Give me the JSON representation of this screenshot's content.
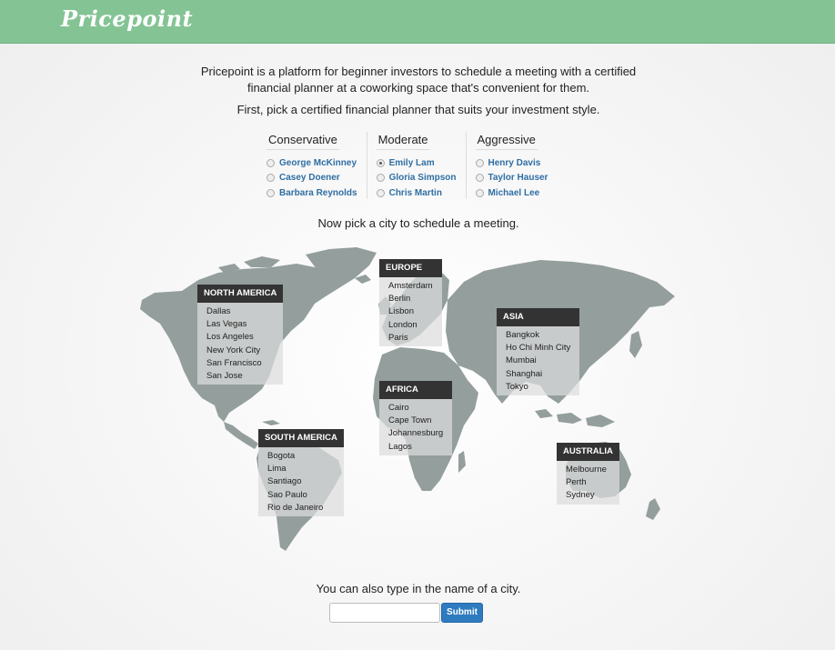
{
  "app": {
    "logo": "Pricepoint"
  },
  "intro": {
    "line1": "Pricepoint is a platform for beginner investors to schedule a meeting with a certified",
    "line2": "financial planner at a coworking space that's convenient for them.",
    "step1": "First, pick a certified financial planner that suits your investment style."
  },
  "planners": [
    {
      "style": "Conservative",
      "names": [
        "George McKinney",
        "Casey Doener",
        "Barbara Reynolds"
      ],
      "selected": null
    },
    {
      "style": "Moderate",
      "names": [
        "Emily Lam",
        "Gloria Simpson",
        "Chris Martin"
      ],
      "selected": 0
    },
    {
      "style": "Aggressive",
      "names": [
        "Henry Davis",
        "Taylor Hauser",
        "Michael Lee"
      ],
      "selected": null
    }
  ],
  "step2": "Now pick a city to schedule a meeting.",
  "regions": [
    {
      "name": "NORTH AMERICA",
      "cities": [
        "Dallas",
        "Las Vegas",
        "Los Angeles",
        "New York City",
        "San Francisco",
        "San Jose"
      ]
    },
    {
      "name": "EUROPE",
      "cities": [
        "Amsterdam",
        "Berlin",
        "Lisbon",
        "London",
        "Paris"
      ]
    },
    {
      "name": "ASIA",
      "cities": [
        "Bangkok",
        "Ho Chi Minh City",
        "Mumbai",
        "Shanghai",
        "Tokyo"
      ]
    },
    {
      "name": "AFRICA",
      "cities": [
        "Cairo",
        "Cape Town",
        "Johannesburg",
        "Lagos"
      ]
    },
    {
      "name": "SOUTH AMERICA",
      "cities": [
        "Bogota",
        "Lima",
        "Santiago",
        "Sao Paulo",
        "Rio de Janeiro"
      ]
    },
    {
      "name": "AUSTRALIA",
      "cities": [
        "Melbourne",
        "Perth",
        "Sydney"
      ]
    }
  ],
  "step3": "You can also type in the name of a city.",
  "search": {
    "value": "",
    "submit_label": "Submit"
  },
  "colors": {
    "header": "#84c494",
    "land": "#939e9d",
    "region_header": "#333333",
    "link": "#2f6ea3",
    "button": "#2f7bc0"
  }
}
